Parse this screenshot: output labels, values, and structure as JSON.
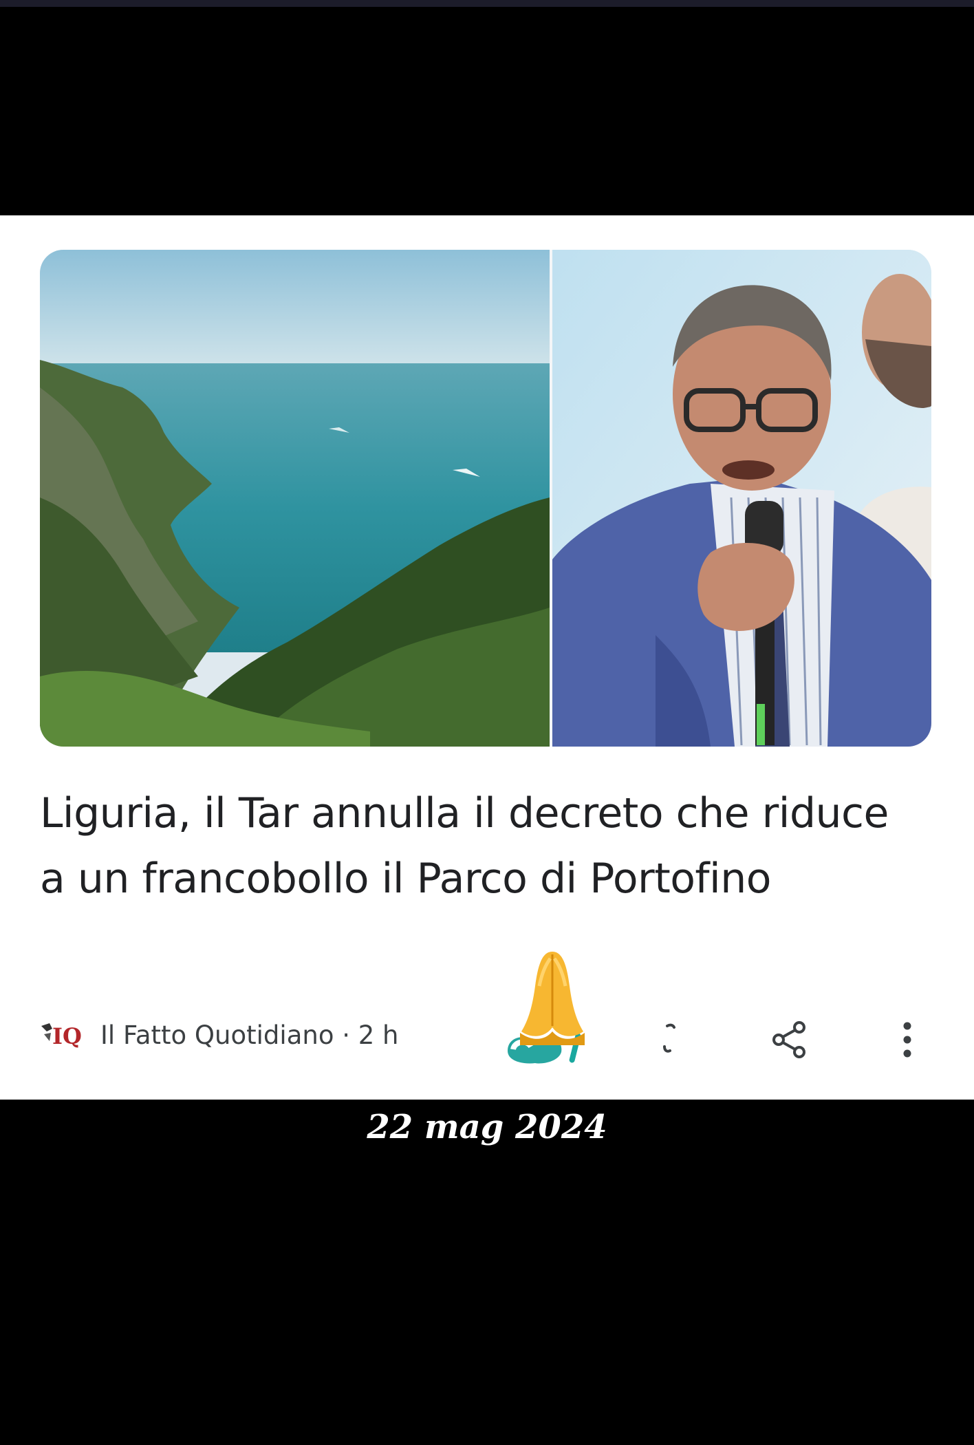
{
  "article": {
    "headline": "Liguria, il Tar annulla il decreto che riduce a un francobollo il Parco di Portofino",
    "source_name": "Il Fatto Quotidiano · 2 h",
    "source_logo_text": "IQ",
    "actions": {
      "bookmark_icon": "bookmark-icon",
      "share_icon": "share-icon",
      "more_icon": "more-vertical-icon"
    },
    "images": [
      {
        "subject": "coastline-photo"
      },
      {
        "subject": "speaker-photo"
      }
    ]
  },
  "overlay": {
    "sticker_emoji": "🙏",
    "date_caption": "22 mag 2024"
  },
  "colors": {
    "background": "#000000",
    "card": "#ffffff",
    "text": "#202124",
    "meta_text": "#3c4043",
    "icon": "#3c4043"
  }
}
